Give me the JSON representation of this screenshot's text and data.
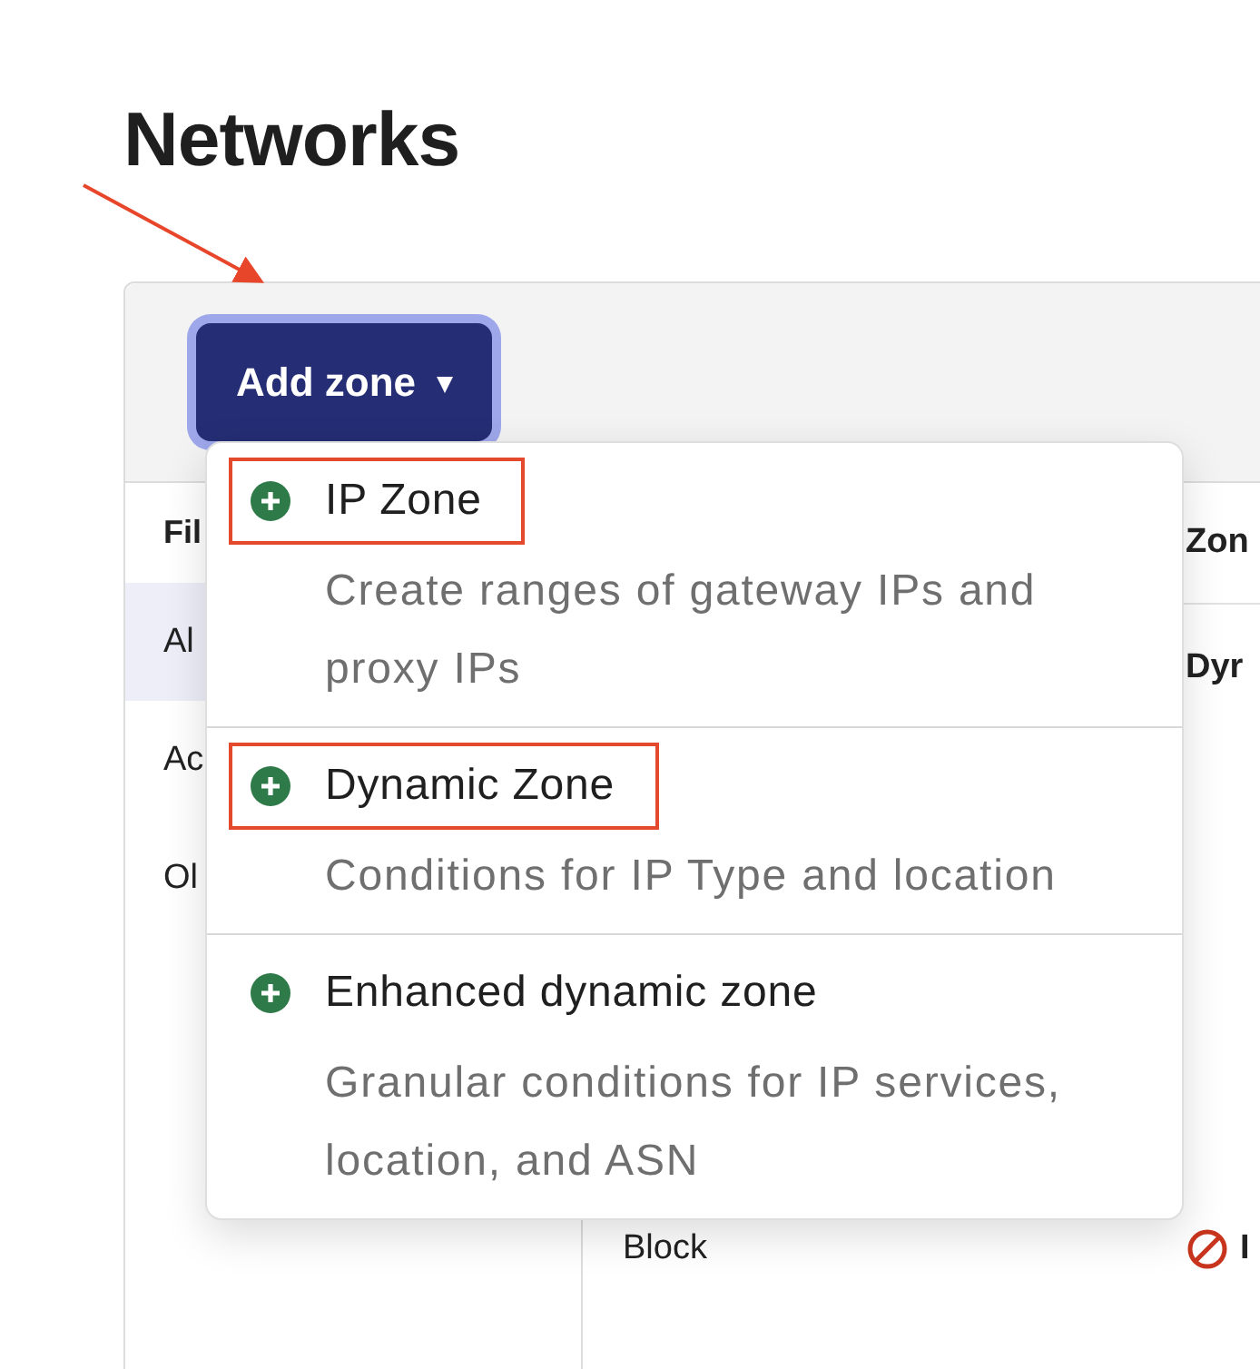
{
  "page": {
    "title": "Networks"
  },
  "toolbar": {
    "add_button": {
      "label": "Add zone",
      "caret": "▾",
      "focused": true
    }
  },
  "filters": {
    "heading": "Fil",
    "items": [
      {
        "label": "Al",
        "selected": true
      },
      {
        "label": "Ac",
        "selected": false
      },
      {
        "label": "Ol",
        "selected": false
      }
    ]
  },
  "table": {
    "columns": [
      "Zon"
    ],
    "rows": [
      {
        "column_1": "",
        "column_2": "Dyr",
        "blocked": false
      },
      {
        "column_1": "Block",
        "column_2": "I",
        "blocked": true
      }
    ]
  },
  "menu": {
    "items": [
      {
        "title": "IP Zone",
        "description": "Create ranges of gateway IPs and proxy IPs",
        "annotated": true
      },
      {
        "title": "Dynamic Zone",
        "description": "Conditions for IP Type and location",
        "annotated": true
      },
      {
        "title": "Enhanced dynamic zone",
        "description": "Granular conditions for IP services, location, and ASN",
        "annotated": false
      }
    ]
  }
}
